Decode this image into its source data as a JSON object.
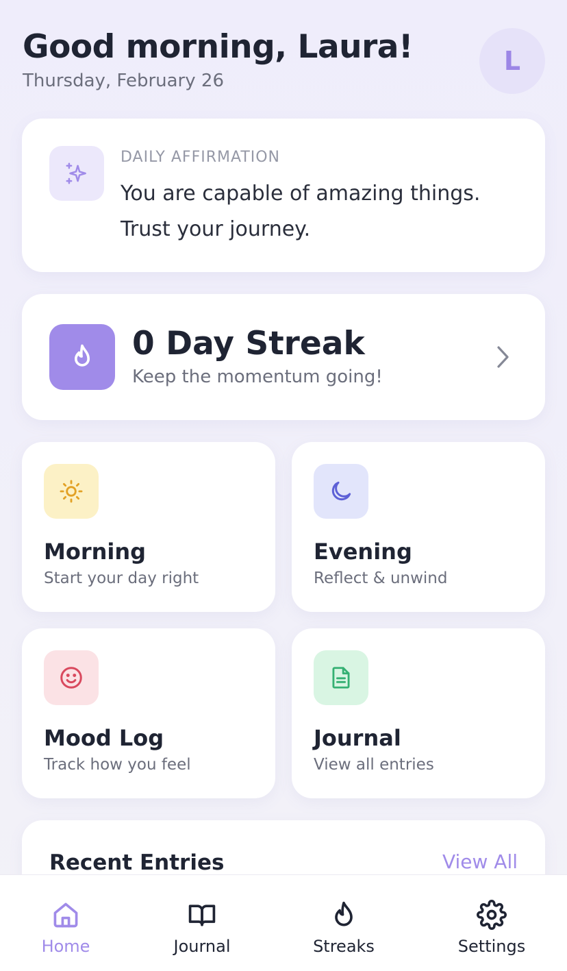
{
  "header": {
    "greeting": "Good morning, Laura!",
    "date": "Thursday, February 26",
    "avatar_initial": "L"
  },
  "affirmation": {
    "label": "DAILY AFFIRMATION",
    "text": "You are capable of amazing things. Trust your journey.",
    "icon": "sparkles-icon"
  },
  "streak": {
    "title": "0 Day Streak",
    "subtitle": "Keep the momentum going!",
    "icon": "flame-icon"
  },
  "tiles": [
    {
      "title": "Morning",
      "subtitle": "Start your day right",
      "icon": "sun-icon",
      "bg": "#fcf1c6",
      "color": "#e2a125"
    },
    {
      "title": "Evening",
      "subtitle": "Reflect & unwind",
      "icon": "moon-icon",
      "bg": "#e2e5fb",
      "color": "#5d60d6"
    },
    {
      "title": "Mood Log",
      "subtitle": "Track how you feel",
      "icon": "smile-icon",
      "bg": "#fbe2e5",
      "color": "#d9495e"
    },
    {
      "title": "Journal",
      "subtitle": "View all entries",
      "icon": "document-icon",
      "bg": "#d9f5e3",
      "color": "#35b073"
    }
  ],
  "recent": {
    "title": "Recent Entries",
    "view_all": "View All"
  },
  "tabbar": {
    "items": [
      {
        "label": "Home",
        "icon": "home-icon",
        "active": true
      },
      {
        "label": "Journal",
        "icon": "book-icon",
        "active": false
      },
      {
        "label": "Streaks",
        "icon": "flame-icon",
        "active": false
      },
      {
        "label": "Settings",
        "icon": "gear-icon",
        "active": false
      }
    ]
  },
  "colors": {
    "accent": "#a08be9",
    "text_primary": "#1f2433",
    "text_secondary": "#6b6e7c"
  }
}
